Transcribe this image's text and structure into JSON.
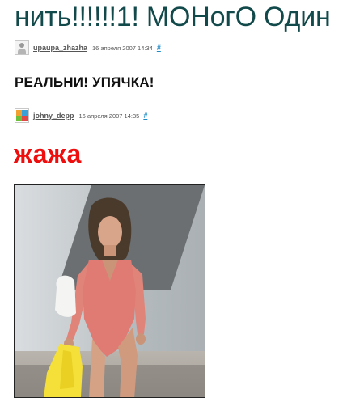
{
  "post": {
    "title": "нить!!!!!!1! МОНогО Один",
    "meta": {
      "username": "upaupa_zhazha",
      "date": "16 апреля 2007 14:34",
      "link": "#",
      "avatar_icon": "default-user-avatar-icon"
    }
  },
  "comments": [
    {
      "text": "РЕАЛЬНИ! УПЯЧКА!",
      "meta": {
        "username": "johny_depp",
        "date": "16 апреля 2007 14:35",
        "link": "#",
        "avatar_icon": "colorful-avatar-icon"
      },
      "red_text": "жажа",
      "photo_icon": "photo-person-with-bag-icon"
    }
  ],
  "colors": {
    "title": "#12494a",
    "red_text": "#ee0e0e",
    "link": "#1c8bc6"
  }
}
